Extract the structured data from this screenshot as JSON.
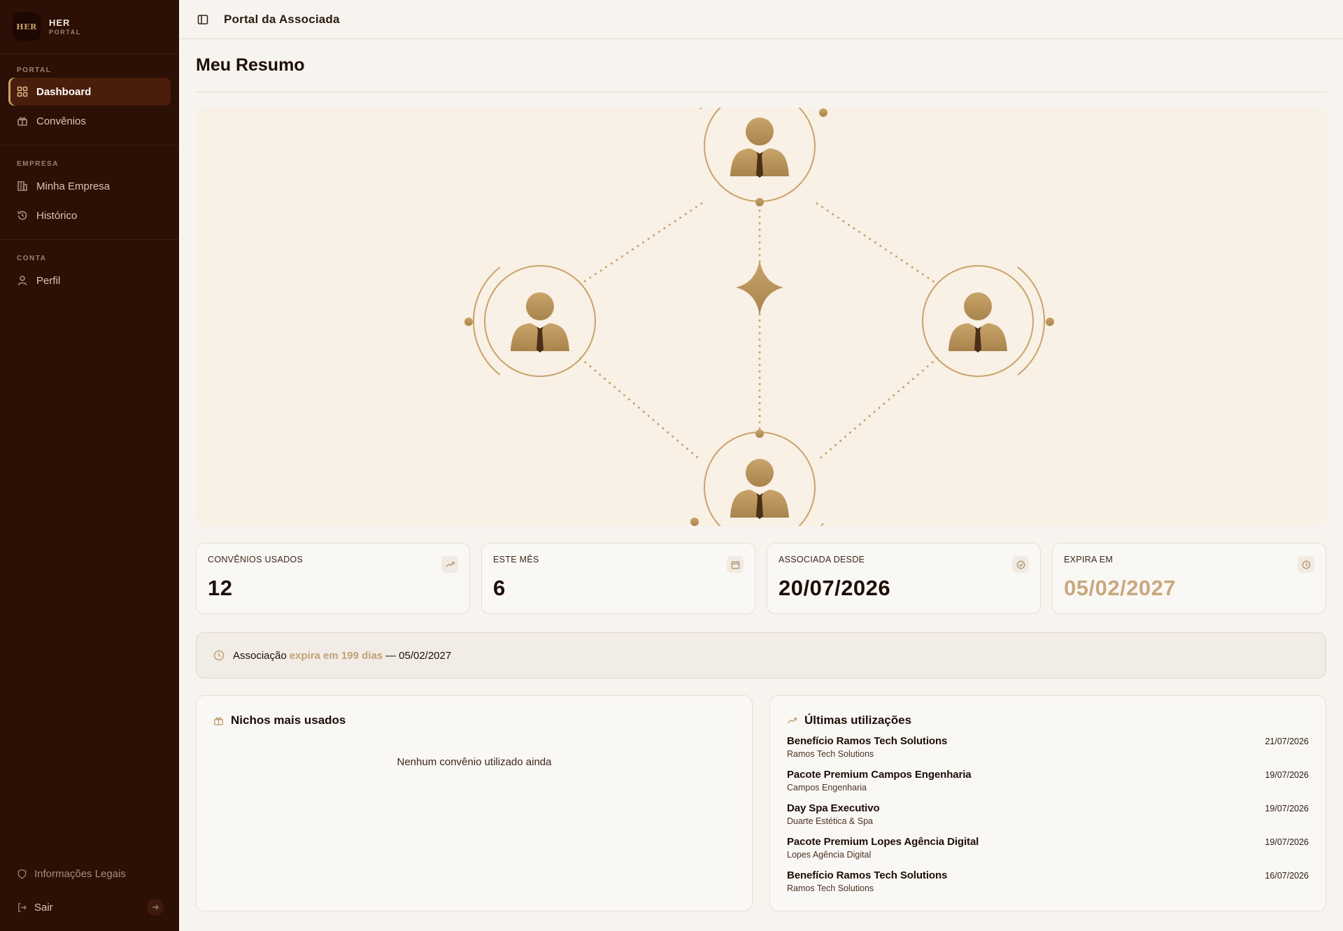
{
  "brand": {
    "logo": "HER",
    "name": "HER",
    "subtitle": "PORTAL"
  },
  "sidebar": {
    "sections": [
      {
        "title": "PORTAL",
        "items": [
          {
            "label": "Dashboard",
            "icon": "dashboard-icon",
            "active": true
          },
          {
            "label": "Convênios",
            "icon": "gift-icon"
          }
        ]
      },
      {
        "title": "EMPRESA",
        "items": [
          {
            "label": "Minha Empresa",
            "icon": "building-icon"
          },
          {
            "label": "Histórico",
            "icon": "history-icon"
          }
        ]
      },
      {
        "title": "CONTA",
        "items": [
          {
            "label": "Perfil",
            "icon": "user-icon"
          }
        ]
      }
    ],
    "legal": "Informações Legais",
    "logout": "Sair"
  },
  "topbar": {
    "title": "Portal da Associada"
  },
  "page": {
    "title": "Meu Resumo"
  },
  "stats": [
    {
      "label": "CONVÊNIOS USADOS",
      "value": "12",
      "icon": "trending-up-icon"
    },
    {
      "label": "ESTE MÊS",
      "value": "6",
      "icon": "calendar-icon"
    },
    {
      "label": "ASSOCIADA DESDE",
      "value": "20/07/2026",
      "icon": "check-circle-icon"
    },
    {
      "label": "EXPIRA EM",
      "value": "05/02/2027",
      "icon": "clock-icon",
      "accent": "#c7a97e"
    }
  ],
  "alert": {
    "prefix": "Associação",
    "highlight": "expira em 199 dias",
    "separator": "—",
    "date": "05/02/2027"
  },
  "niches": {
    "title": "Nichos mais usados",
    "empty": "Nenhum convênio utilizado ainda"
  },
  "recent": {
    "title": "Últimas utilizações",
    "items": [
      {
        "name": "Benefício Ramos Tech Solutions",
        "company": "Ramos Tech Solutions",
        "date": "21/07/2026"
      },
      {
        "name": "Pacote Premium Campos Engenharia",
        "company": "Campos Engenharia",
        "date": "19/07/2026"
      },
      {
        "name": "Day Spa Executivo",
        "company": "Duarte Estética & Spa",
        "date": "19/07/2026"
      },
      {
        "name": "Pacote Premium Lopes Agência Digital",
        "company": "Lopes Agência Digital",
        "date": "19/07/2026"
      },
      {
        "name": "Benefício Ramos Tech Solutions",
        "company": "Ramos Tech Solutions",
        "date": "16/07/2026"
      }
    ]
  },
  "colors": {
    "sidebar": "#2c0f05",
    "gold": "#b8935a",
    "accent": "#c7a97e",
    "background": "#f7f3ee"
  }
}
